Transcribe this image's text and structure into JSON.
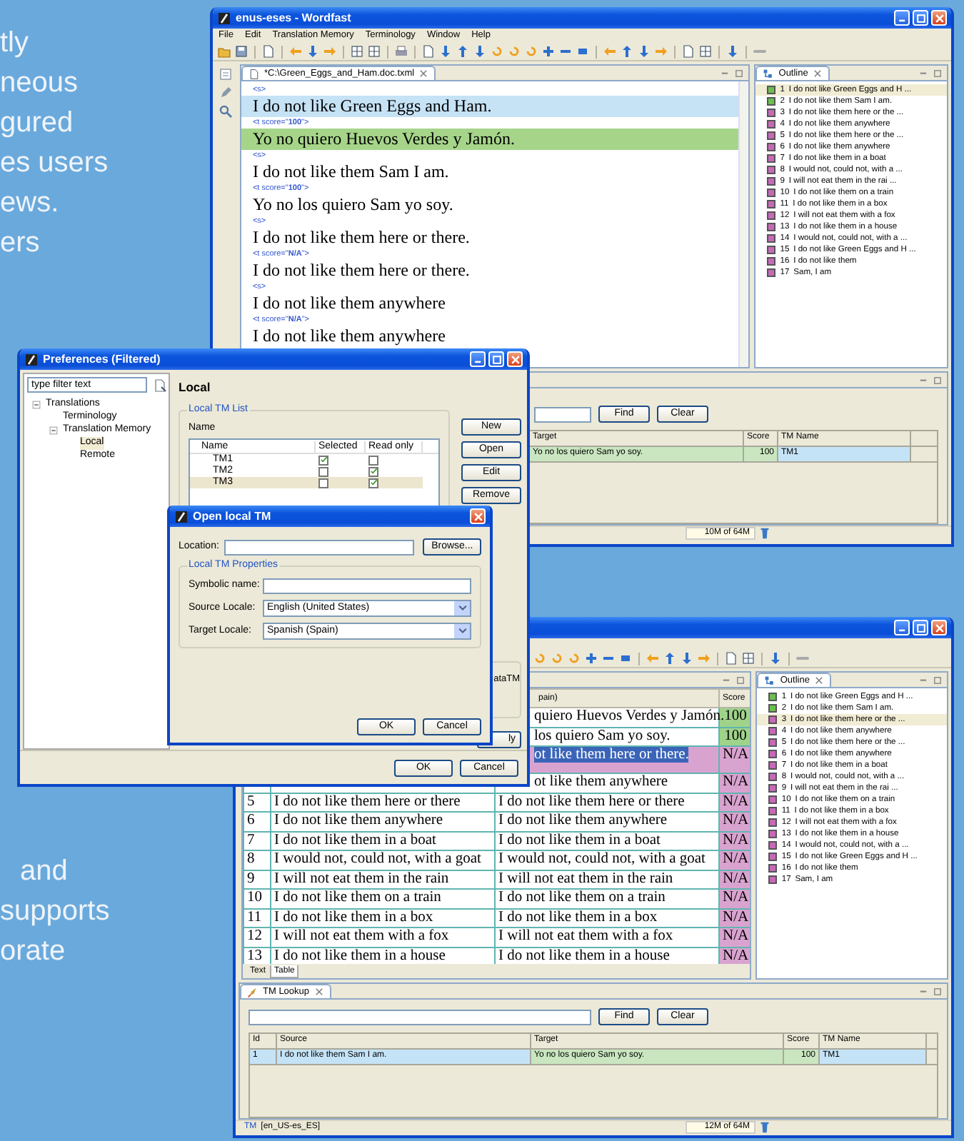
{
  "intro_lines": [
    "tly",
    "neous",
    "gured",
    "es users",
    "ews.",
    "ers"
  ],
  "outro_lines": [
    "and",
    "supports",
    "orate"
  ],
  "main_window": {
    "title": "enus-eses - Wordfast",
    "menu": [
      "File",
      "Edit",
      "Translation Memory",
      "Terminology",
      "Window",
      "Help"
    ],
    "editor_tab": "*C:\\Green_Eggs_and_Ham.doc.txml",
    "segments": [
      {
        "tag": "<s>",
        "text": "I do not like Green Eggs and Ham.",
        "color": "#c6e2f5"
      },
      {
        "tag": "<t score=\"**100**\">",
        "text": "Yo no quiero Huevos Verdes y Jamón.",
        "color": "#a6d58a"
      },
      {
        "tag": "<s>",
        "text": "I do not like them Sam I am."
      },
      {
        "tag": "<t score=\"**100**\">",
        "text": "Yo no los quiero Sam yo soy."
      },
      {
        "tag": "<s>",
        "text": "I do not like them here or there."
      },
      {
        "tag": "<t score=\"**N/A**\">",
        "text": "I do not like them here or there."
      },
      {
        "tag": "<s>",
        "text": "I do not like them anywhere"
      },
      {
        "tag": "<t score=\"**N/A**\">",
        "text": "I do not like them anywhere"
      }
    ],
    "outline": {
      "title": "Outline",
      "items": [
        {
          "number": "1",
          "text": "I do not like Green Eggs and H ...",
          "color": "#6cbf4e",
          "selected": true
        },
        {
          "number": "2",
          "text": "I do not like them Sam I am.",
          "color": "#6cbf4e",
          "selected": false
        },
        {
          "number": "3",
          "text": "I do not like them here or the ...",
          "color": "#c868b8",
          "selected": false
        },
        {
          "number": "4",
          "text": "I do not like them anywhere",
          "color": "#c868b8",
          "selected": false
        },
        {
          "number": "5",
          "text": "I do not like them here or the ...",
          "color": "#c868b8",
          "selected": false
        },
        {
          "number": "6",
          "text": "I do not like them anywhere",
          "color": "#c868b8",
          "selected": false
        },
        {
          "number": "7",
          "text": "I do not like them in a boat",
          "color": "#c868b8",
          "selected": false
        },
        {
          "number": "8",
          "text": "I would not, could not, with a ...",
          "color": "#c868b8",
          "selected": false
        },
        {
          "number": "9",
          "text": "I will not eat them in the rai ...",
          "color": "#c868b8",
          "selected": false
        },
        {
          "number": "10",
          "text": "I do not like them on a train",
          "color": "#c868b8",
          "selected": false
        },
        {
          "number": "11",
          "text": "I do not like them in a box",
          "color": "#c868b8",
          "selected": false
        },
        {
          "number": "12",
          "text": "I will not eat them with a fox",
          "color": "#c868b8",
          "selected": false
        },
        {
          "number": "13",
          "text": "I do not like them in a house",
          "color": "#c868b8",
          "selected": false
        },
        {
          "number": "14",
          "text": "I would not, could not, with a ...",
          "color": "#c868b8",
          "selected": false
        },
        {
          "number": "15",
          "text": "I do not like Green Eggs and H ...",
          "color": "#c868b8",
          "selected": false
        },
        {
          "number": "16",
          "text": "I do not like them",
          "color": "#c868b8",
          "selected": false
        },
        {
          "number": "17",
          "text": "Sam, I am",
          "color": "#c868b8",
          "selected": false
        }
      ]
    },
    "tm_lookup": {
      "find": "Find",
      "clear": "Clear",
      "columns": [
        "Target",
        "Score",
        "TM Name"
      ],
      "rows": [
        {
          "target": "Yo no los quiero Sam yo soy.",
          "score": "100",
          "tm_name": "TM1"
        }
      ]
    },
    "memory": "10M of 64M"
  },
  "second_window": {
    "table": {
      "columns": [
        "pain)",
        "Score"
      ],
      "rows": [
        {
          "target": "quiero Huevos Verdes y Jamón.",
          "score": "100",
          "color": "#9fd38a",
          "selected": false
        },
        {
          "target": "los quiero Sam yo soy.",
          "score": "100",
          "color": "#9fd38a",
          "selected": false
        },
        {
          "target": "ot like them here or there.",
          "score": "N/A",
          "color": "#d9a3cf",
          "selected": true
        },
        {
          "target": "ot like them anywhere",
          "score": "N/A",
          "color": "#d9a3cf",
          "selected": false
        },
        {
          "number": "5",
          "source": "I do not like them here or there",
          "target": "I do not like them here or there",
          "score": "N/A",
          "color": "#d9a3cf",
          "selected": false
        },
        {
          "number": "6",
          "source": "I do not like them anywhere",
          "target": "I do not like them anywhere",
          "score": "N/A",
          "color": "#d9a3cf",
          "selected": false
        },
        {
          "number": "7",
          "source": "I do not like them in a boat",
          "target": "I do not like them in a boat",
          "score": "N/A",
          "color": "#d9a3cf",
          "selected": false
        },
        {
          "number": "8",
          "source": "I would not, could not, with a goat",
          "target": "I would not, could not, with a goat",
          "score": "N/A",
          "color": "#d9a3cf",
          "selected": false
        },
        {
          "number": "9",
          "source": "I will not eat them in the rain",
          "target": "I will not eat them in the rain",
          "score": "N/A",
          "color": "#d9a3cf",
          "selected": false
        },
        {
          "number": "10",
          "source": "I do not like them on a train",
          "target": "I do not like them on a train",
          "score": "N/A",
          "color": "#d9a3cf",
          "selected": false
        },
        {
          "number": "11",
          "source": "I do not like them in a box",
          "target": "I do not like them in a box",
          "score": "N/A",
          "color": "#d9a3cf",
          "selected": false
        },
        {
          "number": "12",
          "source": "I will not eat them with a fox",
          "target": "I will not eat them with a fox",
          "score": "N/A",
          "color": "#d9a3cf",
          "selected": false
        },
        {
          "number": "13",
          "source": "I do not like them in a house",
          "target": "I do not like them in a house",
          "score": "N/A",
          "color": "#d9a3cf",
          "selected": false
        }
      ]
    },
    "view_tabs": [
      {
        "label": "Text",
        "selected": false
      },
      {
        "label": "Table",
        "selected": true
      }
    ],
    "outline": {
      "title": "Outline",
      "items": [
        {
          "number": "1",
          "text": "I do not like Green Eggs and H ...",
          "color": "#6cbf4e",
          "selected": false
        },
        {
          "number": "2",
          "text": "I do not like them Sam I am.",
          "color": "#6cbf4e",
          "selected": false
        },
        {
          "number": "3",
          "text": "I do not like them here or the ...",
          "color": "#c868b8",
          "selected": true
        },
        {
          "number": "4",
          "text": "I do not like them anywhere",
          "color": "#c868b8",
          "selected": false
        },
        {
          "number": "5",
          "text": "I do not like them here or the ...",
          "color": "#c868b8",
          "selected": false
        },
        {
          "number": "6",
          "text": "I do not like them anywhere",
          "color": "#c868b8",
          "selected": false
        },
        {
          "number": "7",
          "text": "I do not like them in a boat",
          "color": "#c868b8",
          "selected": false
        },
        {
          "number": "8",
          "text": "I would not, could not, with a ...",
          "color": "#c868b8",
          "selected": false
        },
        {
          "number": "9",
          "text": "I will not eat them in the rai ...",
          "color": "#c868b8",
          "selected": false
        },
        {
          "number": "10",
          "text": "I do not like them on a train",
          "color": "#c868b8",
          "selected": false
        },
        {
          "number": "11",
          "text": "I do not like them in a box",
          "color": "#c868b8",
          "selected": false
        },
        {
          "number": "12",
          "text": "I will not eat them with a fox",
          "color": "#c868b8",
          "selected": false
        },
        {
          "number": "13",
          "text": "I do not like them in a house",
          "color": "#c868b8",
          "selected": false
        },
        {
          "number": "14",
          "text": "I would not, could not, with a ...",
          "color": "#c868b8",
          "selected": false
        },
        {
          "number": "15",
          "text": "I do not like Green Eggs and H ...",
          "color": "#c868b8",
          "selected": false
        },
        {
          "number": "16",
          "text": "I do not like them",
          "color": "#c868b8",
          "selected": false
        },
        {
          "number": "17",
          "text": "Sam, I am",
          "color": "#c868b8",
          "selected": false
        }
      ]
    },
    "tm_lookup": {
      "title": "TM Lookup",
      "find": "Find",
      "clear": "Clear",
      "columns": [
        "Id",
        "Source",
        "Target",
        "Score",
        "TM Name"
      ],
      "rows": [
        {
          "id": "1",
          "source": "I do not like them Sam I am.",
          "target": "Yo no los quiero Sam yo soy.",
          "score": "100",
          "tm_name": "TM1"
        }
      ]
    },
    "status": {
      "link": "TM",
      "locale": "[en_US-es_ES]",
      "memory": "12M of 64M"
    }
  },
  "preferences": {
    "title": "Preferences (Filtered)",
    "filter": "type filter text",
    "tree": [
      {
        "label": "Translations",
        "expanded": true,
        "selected": false,
        "children": [
          {
            "label": "Terminology",
            "selected": false
          },
          {
            "label": "Translation Memory",
            "expanded": true,
            "selected": false,
            "children": [
              {
                "label": "Local",
                "selected": true
              },
              {
                "label": "Remote",
                "selected": false
              }
            ]
          }
        ]
      }
    ],
    "page_title": "Local",
    "group": "Local TM List",
    "list_label": "Name",
    "columns": [
      "Name",
      "Selected",
      "Read only"
    ],
    "tms": [
      {
        "name": "TM1",
        "in_use": true,
        "read_only": false,
        "selected": false
      },
      {
        "name": "TM2",
        "in_use": false,
        "read_only": true,
        "selected": false
      },
      {
        "name": "TM3",
        "in_use": false,
        "read_only": true,
        "selected": true
      }
    ],
    "buttons": [
      "New",
      "Open",
      "Edit",
      "Remove"
    ],
    "partial_label": "ataTM",
    "partial_button": "ly",
    "footer_buttons": [
      "OK",
      "Cancel"
    ]
  },
  "open_dialog": {
    "title": "Open local TM",
    "location_label": "Location:",
    "browse": "Browse...",
    "group": "Local TM Properties",
    "fields": [
      {
        "label": "Symbolic name:",
        "kind": "text"
      },
      {
        "label": "Source Locale:",
        "kind": "select",
        "value": "English (United States)"
      },
      {
        "label": "Target Locale:",
        "kind": "select",
        "value": "Spanish (Spain)"
      }
    ],
    "buttons": [
      "OK",
      "Cancel"
    ]
  }
}
